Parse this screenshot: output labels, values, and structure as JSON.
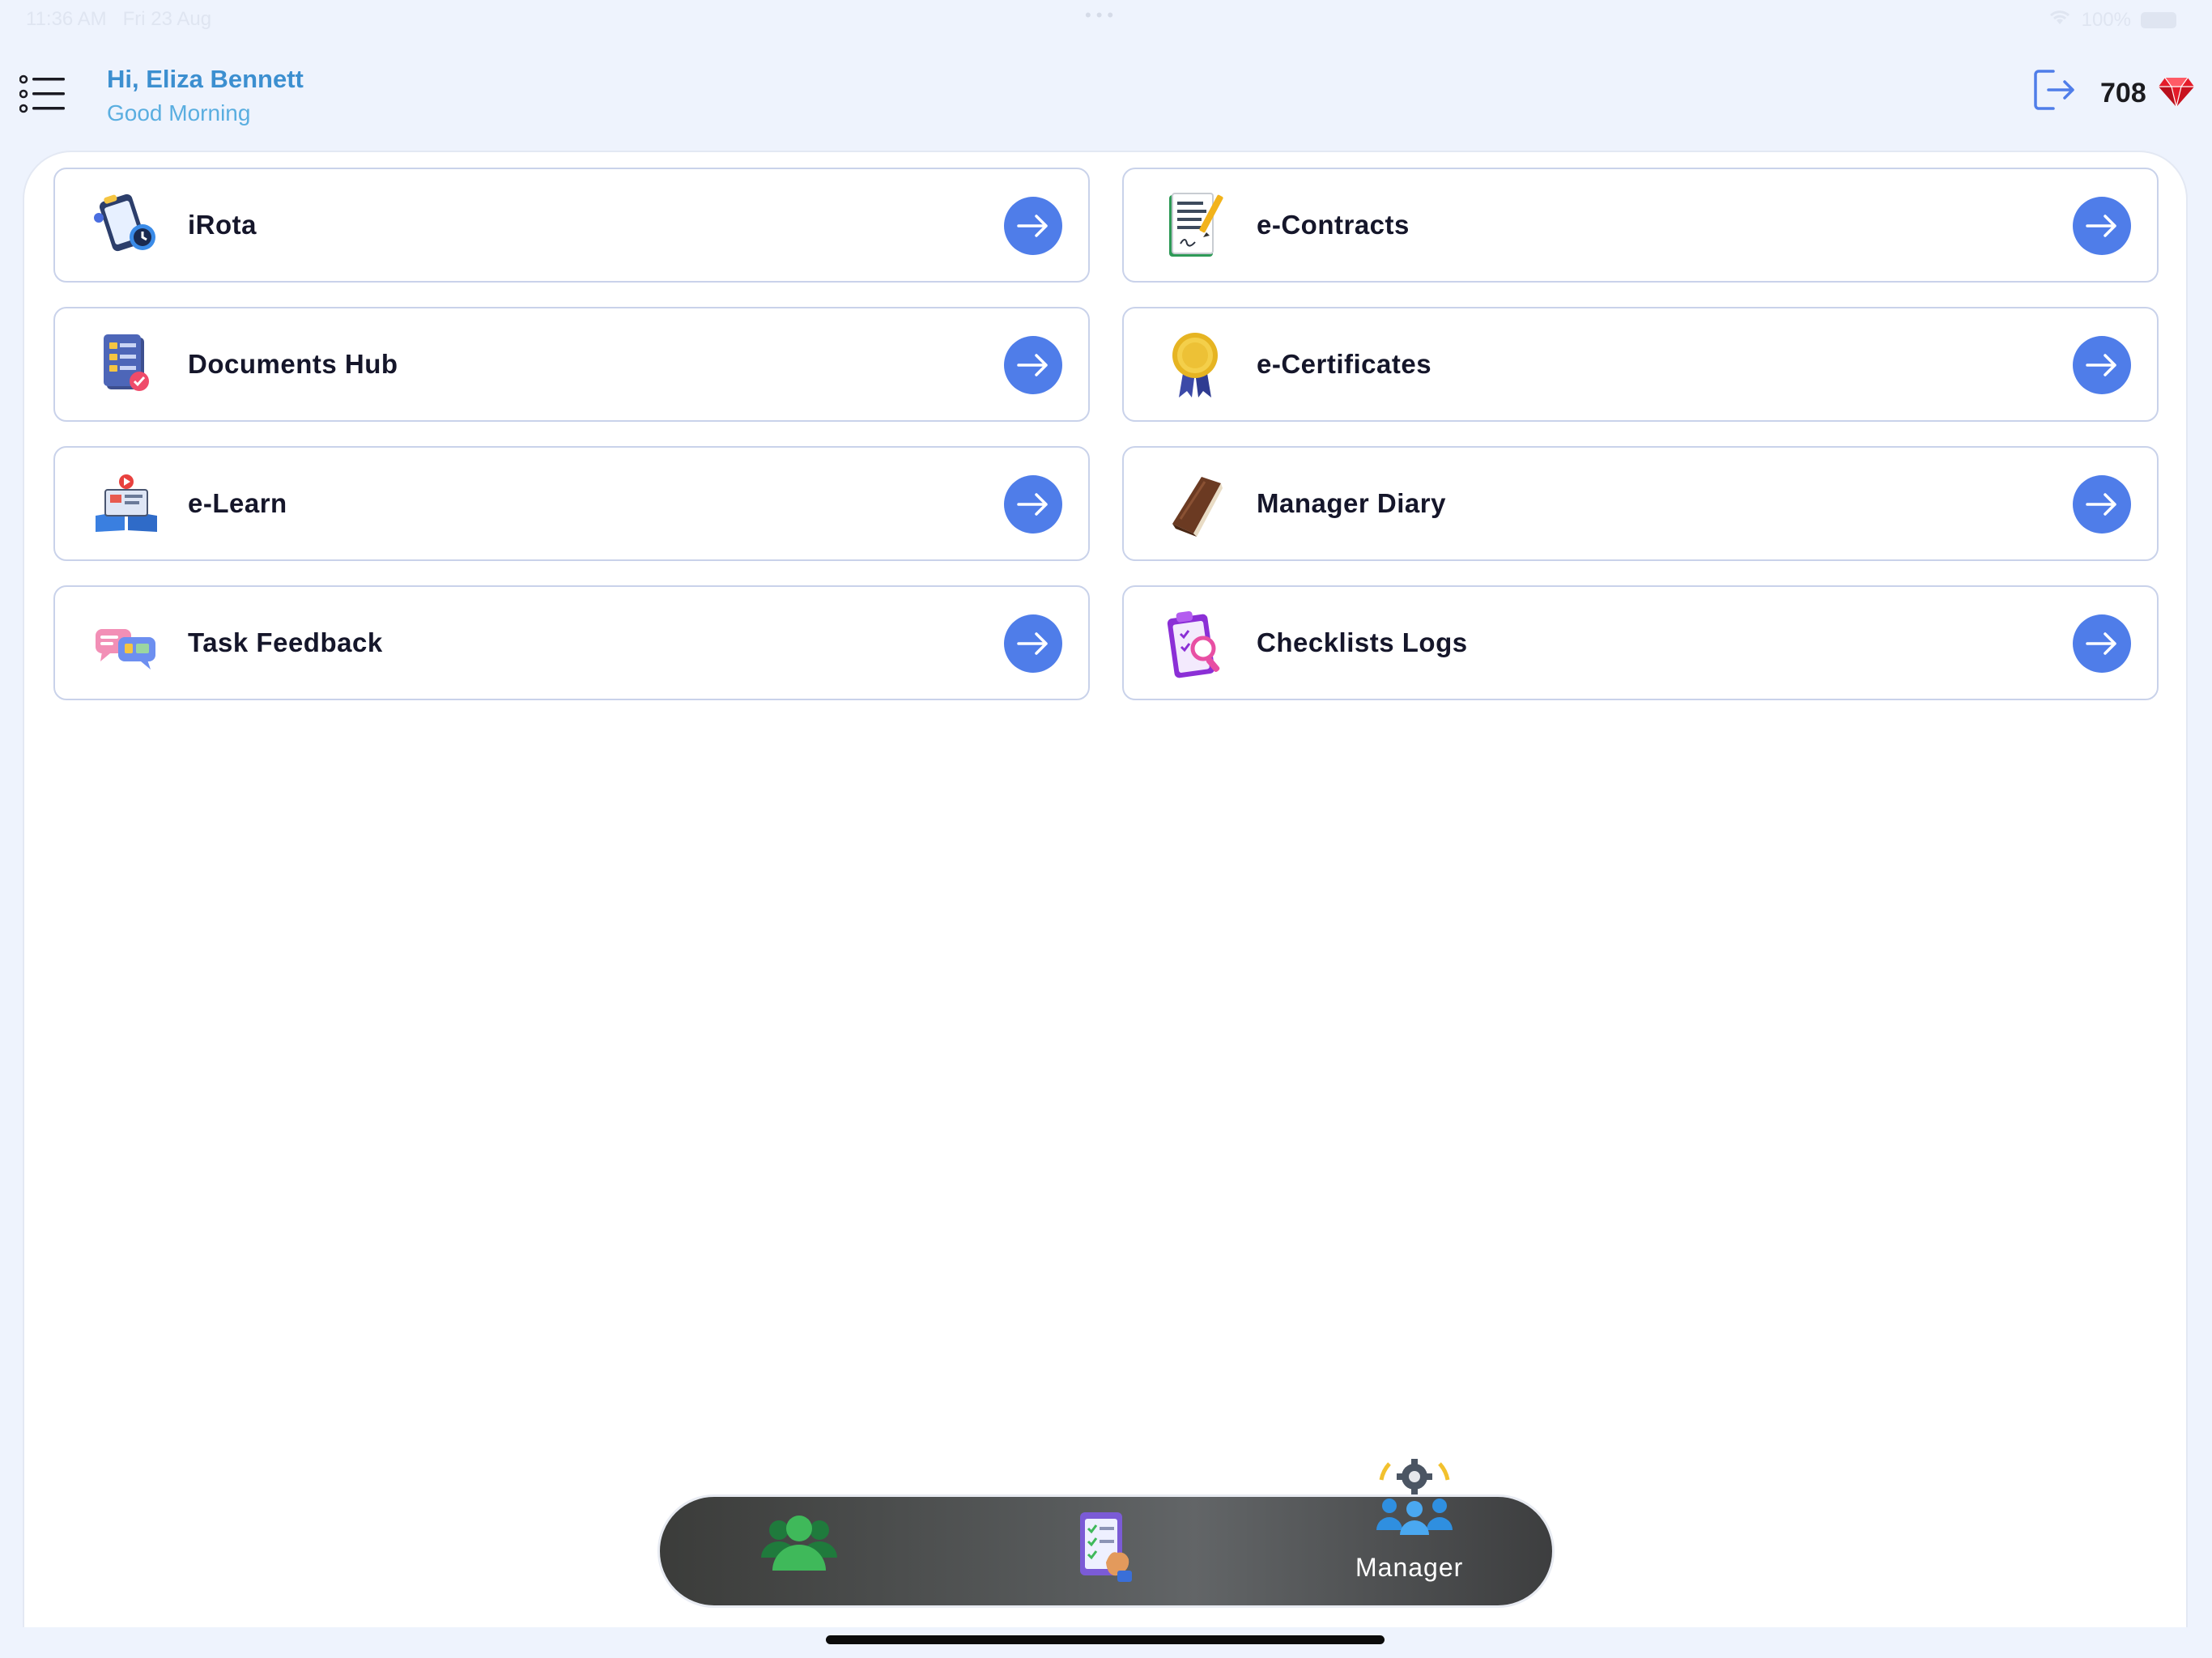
{
  "status_bar": {
    "time": "11:36 AM",
    "date": "Fri 23 Aug",
    "battery": "100%"
  },
  "header": {
    "greeting": "Hi, Eliza Bennett",
    "subgreeting": "Good Morning",
    "points": "708",
    "menu_icon": "list-menu-icon",
    "logout_icon": "logout-icon",
    "points_icon": "ruby-gem-icon"
  },
  "modules": [
    {
      "label": "iRota",
      "icon": "rota-schedule-icon"
    },
    {
      "label": "e-Contracts",
      "icon": "contract-document-icon"
    },
    {
      "label": "Documents Hub",
      "icon": "documents-hub-icon"
    },
    {
      "label": "e-Certificates",
      "icon": "award-medal-icon"
    },
    {
      "label": "e-Learn",
      "icon": "elearning-book-icon"
    },
    {
      "label": "Manager Diary",
      "icon": "diary-book-icon"
    },
    {
      "label": "Task Feedback",
      "icon": "feedback-chat-icon"
    },
    {
      "label": "Checklists Logs",
      "icon": "checklist-search-icon"
    }
  ],
  "bottom_nav": {
    "items": [
      {
        "icon": "team-people-icon"
      },
      {
        "icon": "checklist-hand-icon"
      },
      {
        "icon": "manager-gear-people-icon",
        "label": "Manager",
        "active": true
      }
    ]
  },
  "colors": {
    "accent": "#4f7de9",
    "greeting": "#3c8fd0",
    "background": "#eef3fd"
  }
}
